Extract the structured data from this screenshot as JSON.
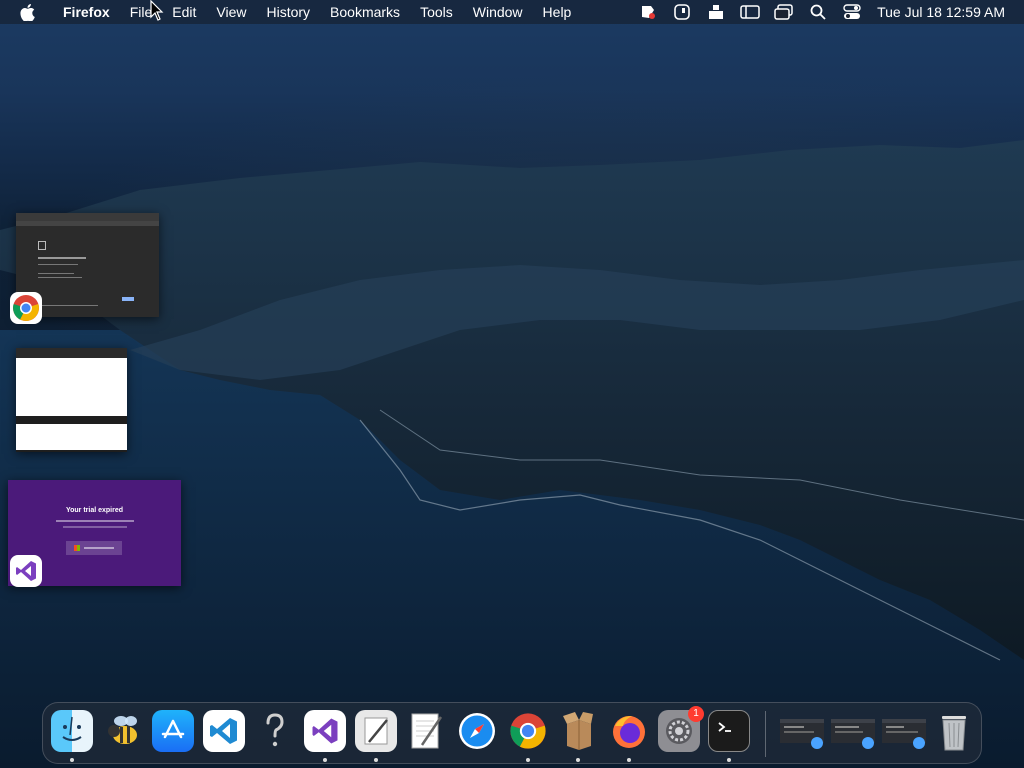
{
  "menubar": {
    "app_name": "Firefox",
    "items": [
      "File",
      "Edit",
      "View",
      "History",
      "Bookmarks",
      "Tools",
      "Window",
      "Help"
    ],
    "clock": "Tue Jul 18  12:59 AM"
  },
  "windows": {
    "vs_trial": {
      "title": "Your trial expired"
    }
  },
  "dock": {
    "notification_count": "1"
  },
  "colors": {
    "menubar": "#1a2230",
    "vs_purple": "#4b1a7a",
    "badge_red": "#ff3b30"
  }
}
